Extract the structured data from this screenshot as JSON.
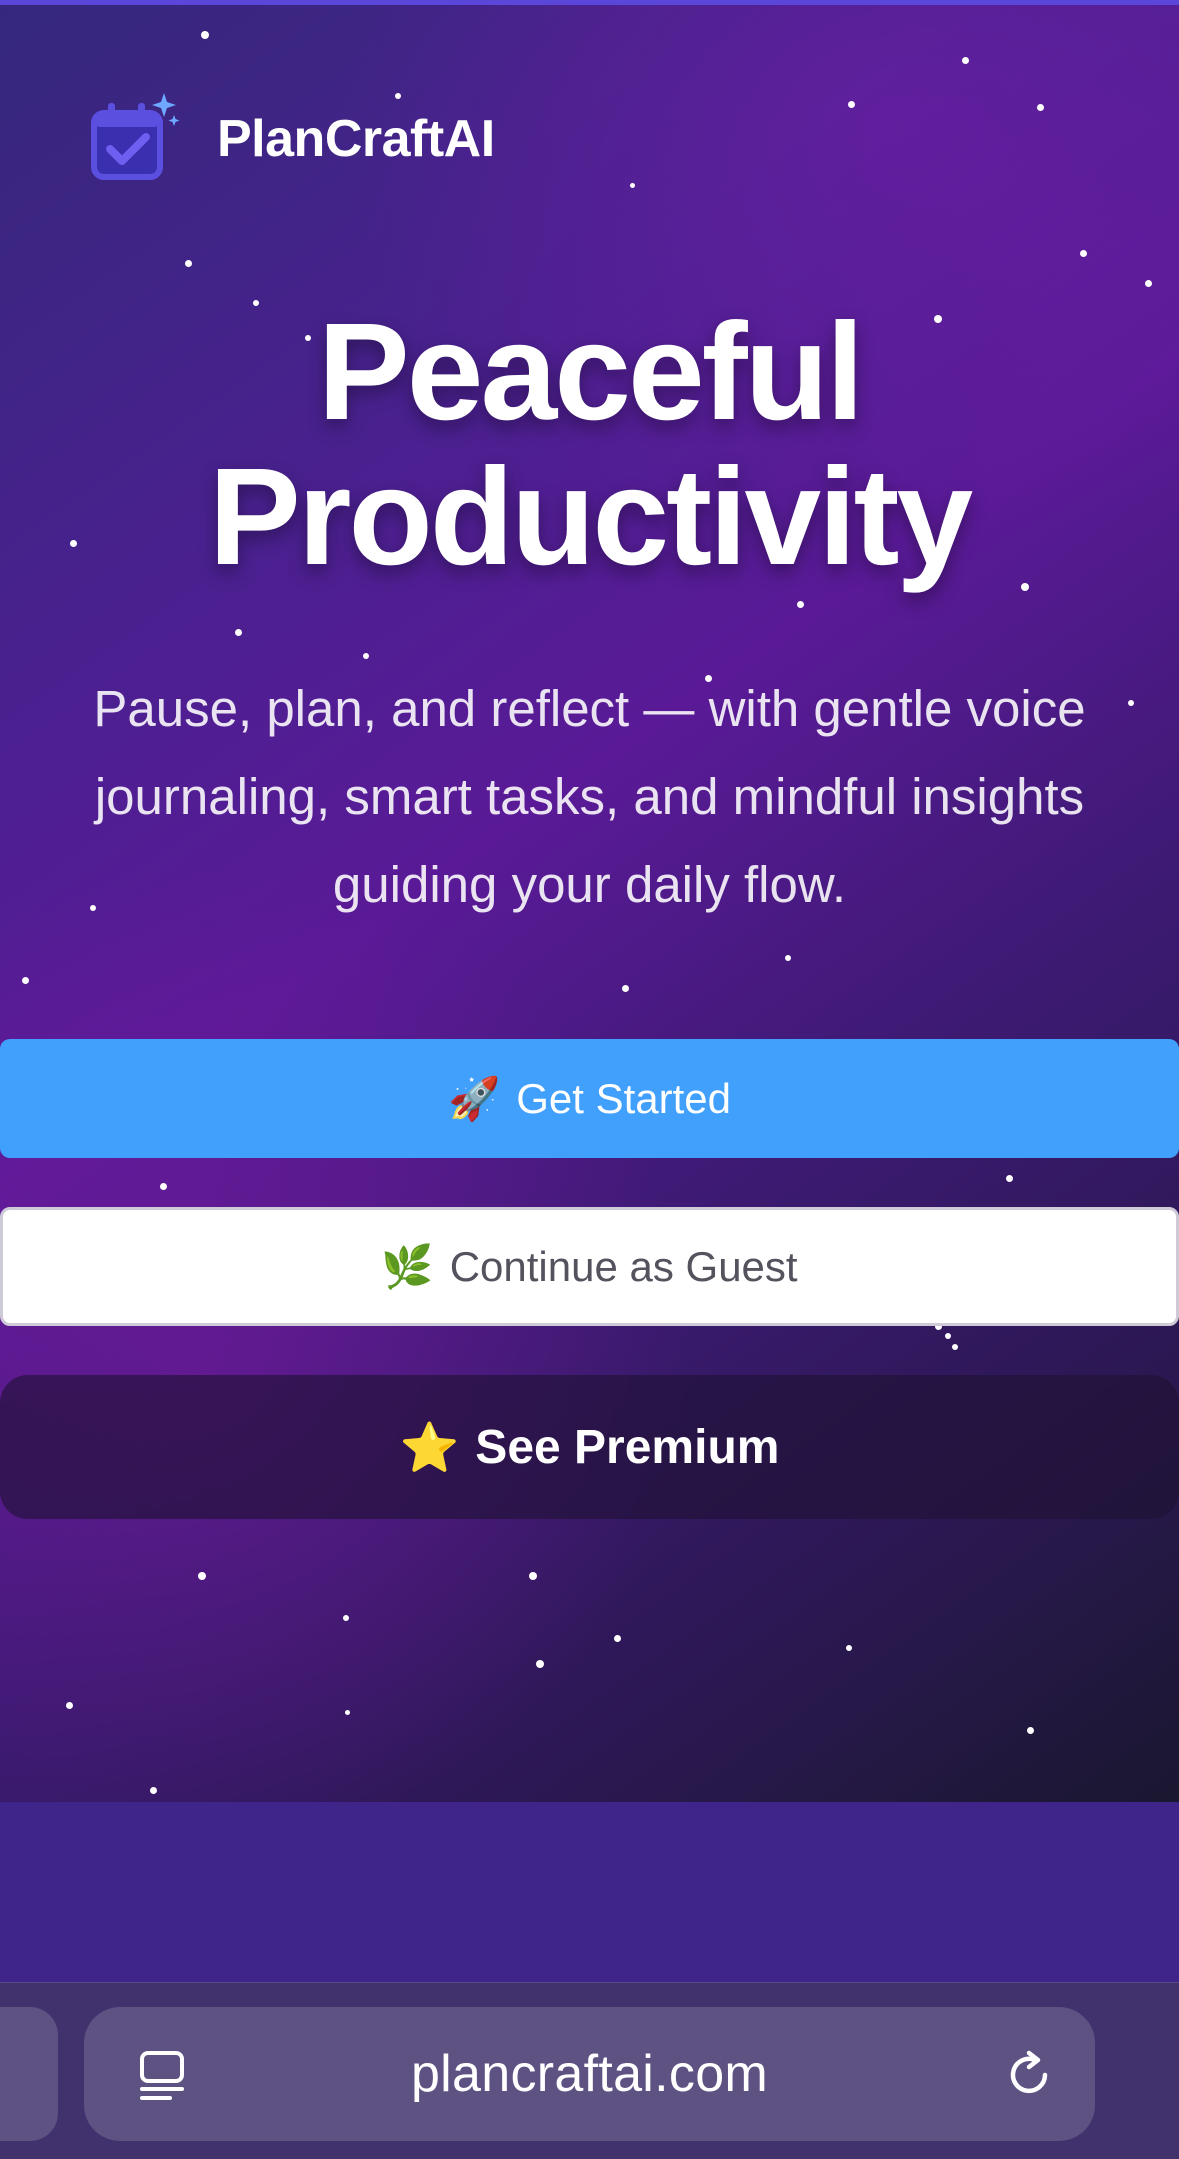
{
  "brand": {
    "name": "PlanCraftAI",
    "accent_color": "#5a3fd6",
    "logo_icon": "calendar-check-sparkle-icon"
  },
  "hero": {
    "headline_line1": "Peaceful",
    "headline_line2": "Productivity",
    "subtitle": "Pause, plan, and reflect — with gentle voice journaling, smart tasks, and mindful insights guiding your daily flow."
  },
  "buttons": {
    "get_started": {
      "emoji": "🚀",
      "label": "Get Started",
      "color": "#41a0fc"
    },
    "guest": {
      "emoji": "🌿",
      "label": "Continue as Guest"
    },
    "premium": {
      "emoji": "⭐",
      "label": "See Premium"
    }
  },
  "browser": {
    "url": "plancraftai.com",
    "left_icon": "reader-mode-icon",
    "right_icon": "reload-icon"
  }
}
